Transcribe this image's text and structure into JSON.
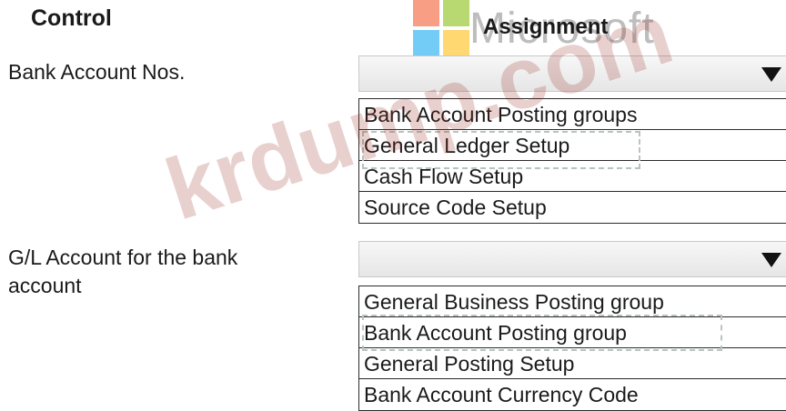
{
  "header": {
    "control_label": "Control",
    "assignment_label": "Assignment",
    "logo_word": "Microsoft"
  },
  "watermark": "krdump.com",
  "controls": [
    {
      "label": "Bank Account Nos.",
      "dropdown_value": "",
      "options": [
        "Bank Account Posting groups",
        "General Ledger Setup",
        "Cash Flow Setup",
        "Source Code Setup"
      ]
    },
    {
      "label": "G/L Account for the bank account",
      "dropdown_value": "",
      "options": [
        "General Business Posting group",
        "Bank Account Posting group",
        "General Posting Setup",
        "Bank Account Currency Code"
      ]
    }
  ],
  "icons": {
    "dropdown_arrow": "chevron-down-icon",
    "logo": "microsoft-logo-icon"
  },
  "colors": {
    "logo_red": "#f25022",
    "logo_green": "#7fba00",
    "logo_blue": "#00a4ef",
    "logo_yellow": "#ffb900",
    "watermark": "#962820"
  }
}
